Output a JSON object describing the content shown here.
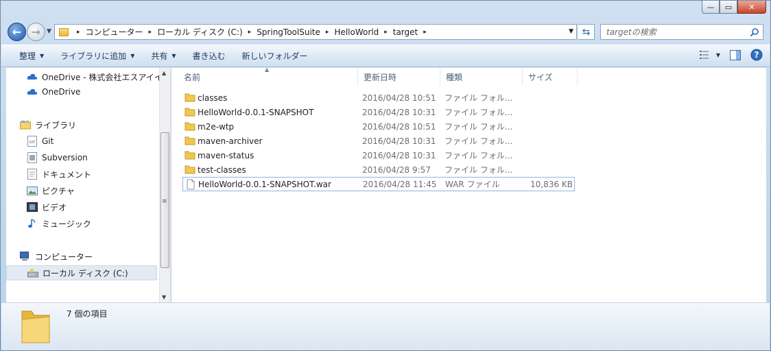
{
  "window": {
    "caption": {
      "minimize": "—",
      "maximize": "▭",
      "close": "✕"
    }
  },
  "address": {
    "breadcrumbs": [
      "コンピューター",
      "ローカル ディスク (C:)",
      "SpringToolSuite",
      "HelloWorld",
      "target"
    ],
    "search_placeholder": "targetの検索"
  },
  "toolbar": {
    "organize": "整理",
    "add_to_library": "ライブラリに追加",
    "share": "共有",
    "burn": "書き込む",
    "new_folder": "新しいフォルダー"
  },
  "nav": {
    "items": [
      {
        "label": "OneDrive - 株式会社エスアイイ",
        "icon": "cloud-icon"
      },
      {
        "label": "OneDrive",
        "icon": "cloud-icon"
      },
      {
        "label": "ライブラリ",
        "icon": "library-icon"
      },
      {
        "label": "Git",
        "icon": "git-icon"
      },
      {
        "label": "Subversion",
        "icon": "subversion-icon"
      },
      {
        "label": "ドキュメント",
        "icon": "document-icon"
      },
      {
        "label": "ピクチャ",
        "icon": "picture-icon"
      },
      {
        "label": "ビデオ",
        "icon": "video-icon"
      },
      {
        "label": "ミュージック",
        "icon": "music-icon"
      },
      {
        "label": "コンピューター",
        "icon": "computer-icon"
      },
      {
        "label": "ローカル ディスク (C:)",
        "icon": "drive-icon"
      }
    ]
  },
  "columns": {
    "name": "名前",
    "date": "更新日時",
    "type": "種類",
    "size": "サイズ"
  },
  "files": [
    {
      "name": "classes",
      "date": "2016/04/28 10:51",
      "type": "ファイル フォル...",
      "size": "",
      "kind": "folder"
    },
    {
      "name": "HelloWorld-0.0.1-SNAPSHOT",
      "date": "2016/04/28 10:31",
      "type": "ファイル フォル...",
      "size": "",
      "kind": "folder"
    },
    {
      "name": "m2e-wtp",
      "date": "2016/04/28 10:51",
      "type": "ファイル フォル...",
      "size": "",
      "kind": "folder"
    },
    {
      "name": "maven-archiver",
      "date": "2016/04/28 10:31",
      "type": "ファイル フォル...",
      "size": "",
      "kind": "folder"
    },
    {
      "name": "maven-status",
      "date": "2016/04/28 10:31",
      "type": "ファイル フォル...",
      "size": "",
      "kind": "folder"
    },
    {
      "name": "test-classes",
      "date": "2016/04/28 9:57",
      "type": "ファイル フォル...",
      "size": "",
      "kind": "folder"
    },
    {
      "name": "HelloWorld-0.0.1-SNAPSHOT.war",
      "date": "2016/04/28 11:45",
      "type": "WAR ファイル",
      "size": "10,836 KB",
      "kind": "file"
    }
  ],
  "status": {
    "item_count": "7 個の項目"
  },
  "colors": {
    "accent": "#2359a8",
    "folder": "#e6b93b",
    "selection_border": "#8fb5e3"
  }
}
